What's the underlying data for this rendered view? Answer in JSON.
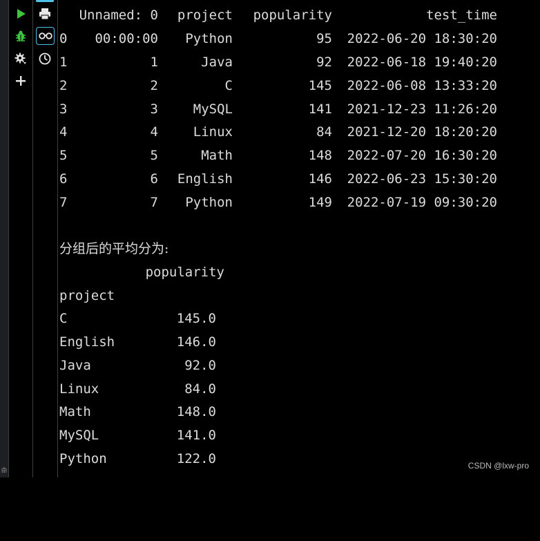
{
  "sidebar_left": {
    "edge_label": "命"
  },
  "toolbar1": {
    "run_icon": "play-icon",
    "debug_icon": "bug-icon",
    "settings_icon": "gear-icon",
    "add_icon": "plus-icon",
    "run_color": "#3ec43e"
  },
  "toolbar2": {
    "print_icon": "printer-icon",
    "view_icon": "glasses-icon",
    "history_icon": "clock-icon",
    "accent_color": "#4fc1e9"
  },
  "table1": {
    "headers": [
      "Unnamed: 0",
      "project",
      "popularity",
      "test_time"
    ],
    "rows": [
      {
        "index": "0",
        "unnamed": "00:00:00",
        "project": "Python",
        "popularity": "95",
        "test_time": "2022-06-20 18:30:20"
      },
      {
        "index": "1",
        "unnamed": "1",
        "project": "Java",
        "popularity": "92",
        "test_time": "2022-06-18 19:40:20"
      },
      {
        "index": "2",
        "unnamed": "2",
        "project": "C",
        "popularity": "145",
        "test_time": "2022-06-08 13:33:20"
      },
      {
        "index": "3",
        "unnamed": "3",
        "project": "MySQL",
        "popularity": "141",
        "test_time": "2021-12-23 11:26:20"
      },
      {
        "index": "4",
        "unnamed": "4",
        "project": "Linux",
        "popularity": "84",
        "test_time": "2021-12-20 18:20:20"
      },
      {
        "index": "5",
        "unnamed": "5",
        "project": "Math",
        "popularity": "148",
        "test_time": "2022-07-20 16:30:20"
      },
      {
        "index": "6",
        "unnamed": "6",
        "project": "English",
        "popularity": "146",
        "test_time": "2022-06-23 15:30:20"
      },
      {
        "index": "7",
        "unnamed": "7",
        "project": "Python",
        "popularity": "149",
        "test_time": "2022-07-19 09:30:20"
      }
    ]
  },
  "group_section": {
    "caption": "分组后的平均分为:",
    "column_header": "popularity",
    "index_name": "project",
    "rows": [
      {
        "project": "C",
        "popularity": "145.0"
      },
      {
        "project": "English",
        "popularity": "146.0"
      },
      {
        "project": "Java",
        "popularity": "92.0"
      },
      {
        "project": "Linux",
        "popularity": "84.0"
      },
      {
        "project": "Math",
        "popularity": "148.0"
      },
      {
        "project": "MySQL",
        "popularity": "141.0"
      },
      {
        "project": "Python",
        "popularity": "122.0"
      }
    ]
  },
  "watermark": "CSDN @lxw-pro"
}
